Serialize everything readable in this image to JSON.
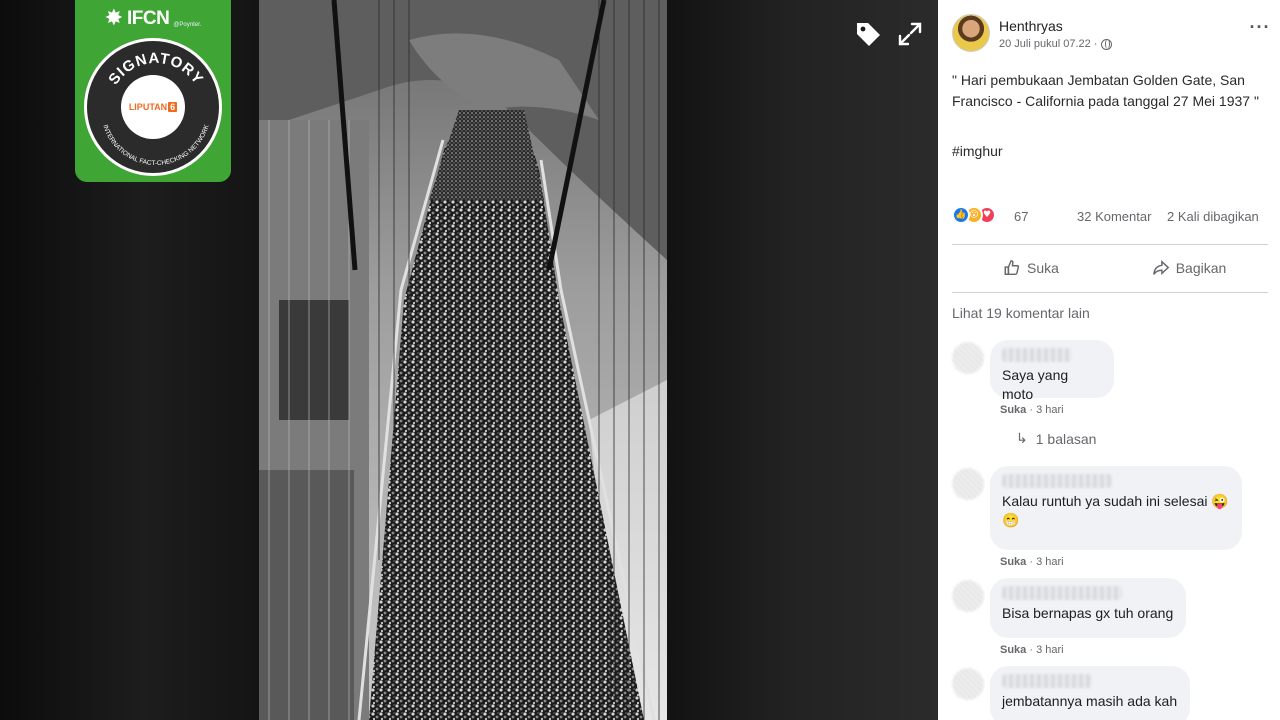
{
  "post": {
    "author": "Henthryas",
    "date": "20 Juli pukul 07.22 ·",
    "caption": "\" Hari pembukaan Jembatan Golden Gate, San Francisco - California pada tanggal 27 Mei 1937 \"",
    "hashtag": "#imghur",
    "reaction_count": "67",
    "comment_count": "32 Komentar",
    "share_count": "2 Kali dibagikan",
    "reactions": [
      "like",
      "wow",
      "love"
    ]
  },
  "actions": {
    "like_label": "Suka",
    "share_label": "Bagikan"
  },
  "comments_section": {
    "more_comments": "Lihat 19 komentar lain",
    "items": [
      {
        "text": "Saya yang moto",
        "like_label": "Suka",
        "time": "3 hari",
        "replies": "1 balasan"
      },
      {
        "text": "Kalau runtuh ya sudah ini selesai 😜 😁",
        "like_label": "Suka",
        "time": "3 hari"
      },
      {
        "text": "Bisa bernapas gx tuh orang",
        "like_label": "Suka",
        "time": "3 hari"
      },
      {
        "text": "jembatannya masih ada kah"
      }
    ]
  },
  "badge": {
    "ifcn": "IFCN",
    "poynter": "@Poynter.",
    "signatory": "SIGNATORY",
    "network": "INTERNATIONAL FACT-CHECKING NETWORK",
    "liputan_text": "LIPUTAN",
    "liputan_num": "6"
  },
  "viewer": {
    "icons": [
      "tag-icon",
      "expand-icon"
    ]
  },
  "colors": {
    "badge_green": "#3fa535",
    "facebook_blue": "#1877f2",
    "liputan_orange": "#ef6b23",
    "comment_bubble": "#f0f2f5"
  }
}
